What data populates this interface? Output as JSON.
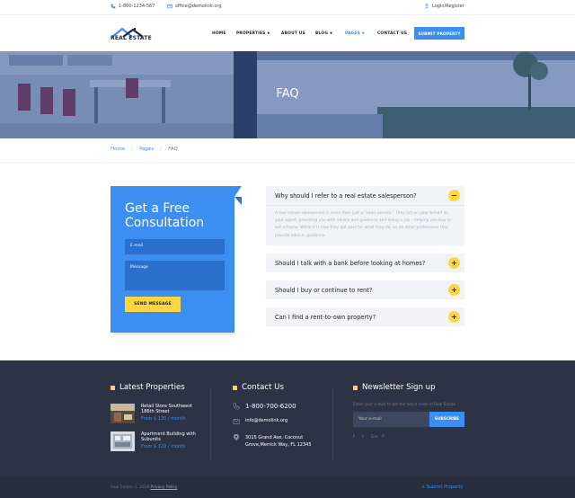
{
  "topbar": {
    "phone": "1-800-1234-567",
    "email": "office@demolink.org",
    "login": "Login/Register"
  },
  "header": {
    "logo_text": "REAL ESTATE",
    "nav": [
      {
        "label": "HOME",
        "has_dropdown": false,
        "active": false
      },
      {
        "label": "PROPERTIES",
        "has_dropdown": true,
        "active": false
      },
      {
        "label": "ABOUT US",
        "has_dropdown": false,
        "active": false
      },
      {
        "label": "BLOG",
        "has_dropdown": true,
        "active": false
      },
      {
        "label": "PAGES",
        "has_dropdown": true,
        "active": true
      },
      {
        "label": "CONTACT US",
        "has_dropdown": false,
        "active": false
      }
    ],
    "submit_label": "SUBMIT PROPERTY"
  },
  "hero": {
    "title": "FAQ"
  },
  "breadcrumb": {
    "home": "Home",
    "pages": "Pages",
    "current": "FAQ"
  },
  "consultation": {
    "title": "Get a Free Consultation",
    "email_placeholder": "E-mail",
    "message_placeholder": "Message",
    "send_label": "SEND MESSAGE"
  },
  "faq": [
    {
      "question": "Why should I refer to a real estate salesperson?",
      "expanded": true,
      "answer": "A real estate salesperson is more than just a \"sales person.\" They act on your behalf as your agent, providing you with advice and guidance and doing a job – helping you buy or sell a home. While it is true they get paid for what they do, so do other professions that provide advice, guidance."
    },
    {
      "question": "Should I talk with a bank before looking at homes?",
      "expanded": false
    },
    {
      "question": "Should I buy or continue to rent?",
      "expanded": false
    },
    {
      "question": "Can I find a rent-to-own property?",
      "expanded": false
    }
  ],
  "footer": {
    "latest": {
      "title": "Latest Properties",
      "items": [
        {
          "title": "Retail Store Southwest 186th Street",
          "price": "From $ 120 / month"
        },
        {
          "title": "Apartment Building with Subunits",
          "price": "From $ 120 / month"
        }
      ]
    },
    "contact": {
      "title": "Contact Us",
      "phone": "1-800-700-6200",
      "email": "info@demolink.org",
      "address": "3015 Grand Ave, Coconut Grove,Merrick Way, FL 12345"
    },
    "newsletter": {
      "title": "Newsletter Sign up",
      "text": "Enter your e-mail to get the latest news of Real Estate",
      "placeholder": "Your e-mail",
      "subscribe_label": "SUBSCRIBE",
      "social": [
        "f",
        "t",
        "G+",
        "P"
      ]
    },
    "copyright": "Real Estate © 2018",
    "privacy": "Privacy Policy",
    "submit_link": "+ Submit Property"
  },
  "colors": {
    "accent": "#3c8ef0",
    "yellow": "#ffd641",
    "footer_bg": "#2c3345"
  }
}
